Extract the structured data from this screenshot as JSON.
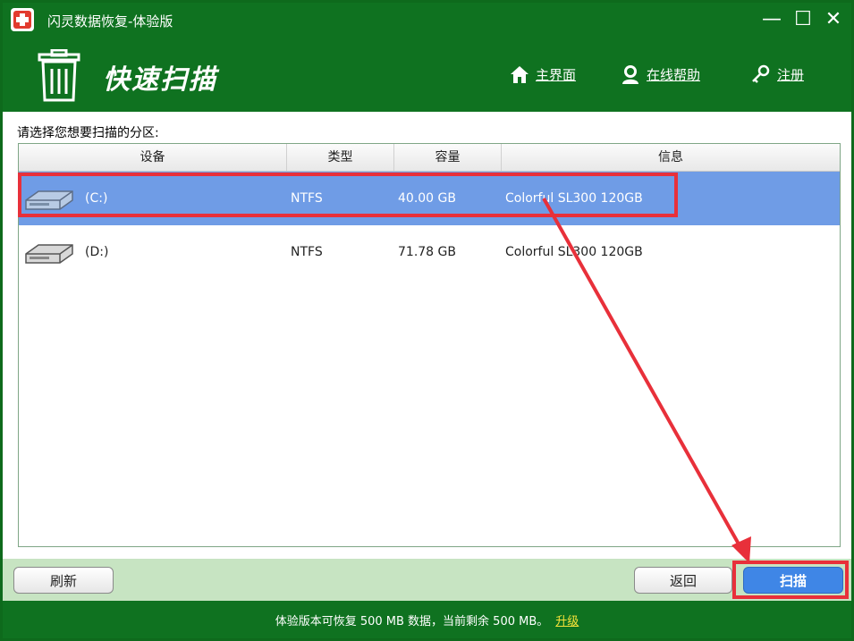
{
  "window": {
    "title": "闪灵数据恢复-体验版",
    "minimize_glyph": "—",
    "maximize_glyph": "☐",
    "close_glyph": "✕"
  },
  "header": {
    "title": "快速扫描",
    "nav": [
      {
        "label": "主界面",
        "icon": "home-icon"
      },
      {
        "label": "在线帮助",
        "icon": "support-icon"
      },
      {
        "label": "注册",
        "icon": "key-icon"
      }
    ]
  },
  "main": {
    "prompt": "请选择您想要扫描的分区:",
    "columns": [
      "设备",
      "类型",
      "容量",
      "信息"
    ],
    "rows": [
      {
        "device": "(C:)",
        "type": "NTFS",
        "capacity": "40.00 GB",
        "info": "Colorful SL300 120GB",
        "selected": true
      },
      {
        "device": "(D:)",
        "type": "NTFS",
        "capacity": "71.78 GB",
        "info": "Colorful SL300 120GB",
        "selected": false
      }
    ]
  },
  "toolbar": {
    "refresh_label": "刷新",
    "back_label": "返回",
    "scan_label": "扫描"
  },
  "status": {
    "message": "体验版本可恢复 500 MB 数据，当前剩余 500 MB。",
    "upgrade_label": "升级"
  },
  "colors": {
    "brand_green": "#0f7220",
    "selection_blue": "#6f9ce6",
    "scan_button": "#3f86e6",
    "annotation_red": "#e8303a",
    "upgrade_link": "#f6e23a"
  }
}
